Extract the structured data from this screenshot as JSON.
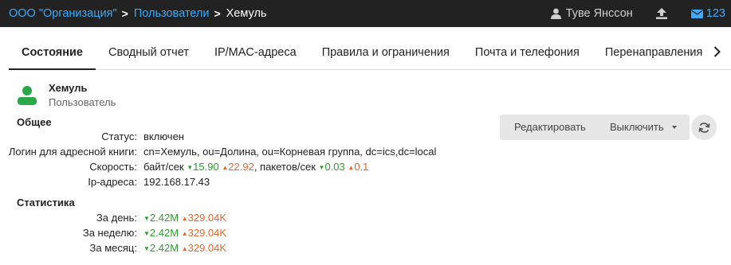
{
  "breadcrumb": {
    "org": "ООО \"Организация\"",
    "users": "Пользователи",
    "current": "Хемуль"
  },
  "topbar": {
    "user_name": "Туве Янссон",
    "mail_count": "123",
    "user_icon": "user-icon",
    "upload_icon": "upload-icon",
    "mail_icon": "envelope-icon"
  },
  "tabs": [
    {
      "label": "Состояние",
      "active": true
    },
    {
      "label": "Сводный отчет"
    },
    {
      "label": "IP/MAC-адреса"
    },
    {
      "label": "Правила и ограничения"
    },
    {
      "label": "Почта и телефония"
    },
    {
      "label": "Перенаправления"
    }
  ],
  "user": {
    "name": "Хемуль",
    "role": "Пользователь"
  },
  "general": {
    "title": "Общее",
    "status_label": "Статус:",
    "status_value": "включен",
    "login_label": "Логин для адресной книги:",
    "login_value": "cn=Хемуль, ou=Долина, ou=Корневая группа, dc=ics,dc=local",
    "speed_label": "Скорость:",
    "speed_bytes_prefix": "байт/сек",
    "speed_bytes_down": "15.90",
    "speed_bytes_up": "22.92",
    "speed_packets_prefix": ", пакетов/сек",
    "speed_packets_down": "0.03",
    "speed_packets_up": "0.1",
    "ip_label": "Ip-адреса:",
    "ip_value": "192.168.17.43"
  },
  "stats": {
    "title": "Статистика",
    "rows": [
      {
        "label": "За день:",
        "down": "2.42M",
        "up": "329.04K"
      },
      {
        "label": "За неделю:",
        "down": "2.42M",
        "up": "329.04K"
      },
      {
        "label": "За месяц:",
        "down": "2.42M",
        "up": "329.04K"
      }
    ]
  },
  "actions": {
    "edit": "Редактировать",
    "disable": "Выключить",
    "refresh_icon": "refresh-icon"
  },
  "colors": {
    "navbar": "#222222",
    "link": "#3fa9f5",
    "down": "#2a9d2a",
    "up": "#e8662a",
    "avatar": "#2ca84a"
  }
}
